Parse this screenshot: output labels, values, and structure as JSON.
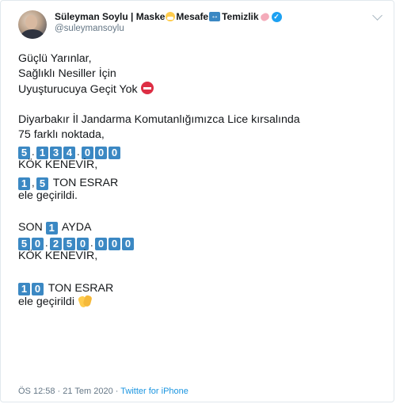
{
  "author": {
    "name_part1": "Süleyman Soylu | Maske",
    "name_part2": "Mesafe",
    "name_part3": "Temizlik",
    "handle": "@suleymansoylu",
    "verified": true,
    "emojis": [
      "mask-emoji",
      "left-right-arrow-emoji",
      "soap-emoji"
    ]
  },
  "tweet": {
    "l1": "Güçlü Yarınlar,",
    "l2": "Sağlıklı Nesiller İçin",
    "l3": "Uyuşturucuya Geçit Yok",
    "l4": "Diyarbakır İl Jandarma Komutanlığımızca Lice kırsalında",
    "l5": "75 farklı noktada,",
    "n1": [
      "5",
      ".",
      "1",
      "3",
      "4",
      ".",
      "0",
      "0",
      "0"
    ],
    "l6": "KÖK KENEVİR,",
    "n2": [
      "1",
      ",",
      "5"
    ],
    "l7": "TON ESRAR",
    "l8": "ele geçirildi.",
    "l9_pre": "SON",
    "n3": [
      "1"
    ],
    "l9_post": "AYDA",
    "n4": [
      "5",
      "0",
      ".",
      "2",
      "5",
      "0",
      ".",
      "0",
      "0",
      "0"
    ],
    "l10": "KÖK KENEVİR,",
    "n5": [
      "1",
      "0"
    ],
    "l11": "TON ESRAR",
    "l12": "ele geçirildi"
  },
  "meta": {
    "time": "ÖS 12:58",
    "date": "21 Tem 2020",
    "client": "Twitter for iPhone",
    "separator": "·"
  },
  "colors": {
    "keycap": "#3b88c3",
    "verified": "#1da1f2",
    "link": "#1b95e0",
    "secondary_text": "#657786"
  }
}
